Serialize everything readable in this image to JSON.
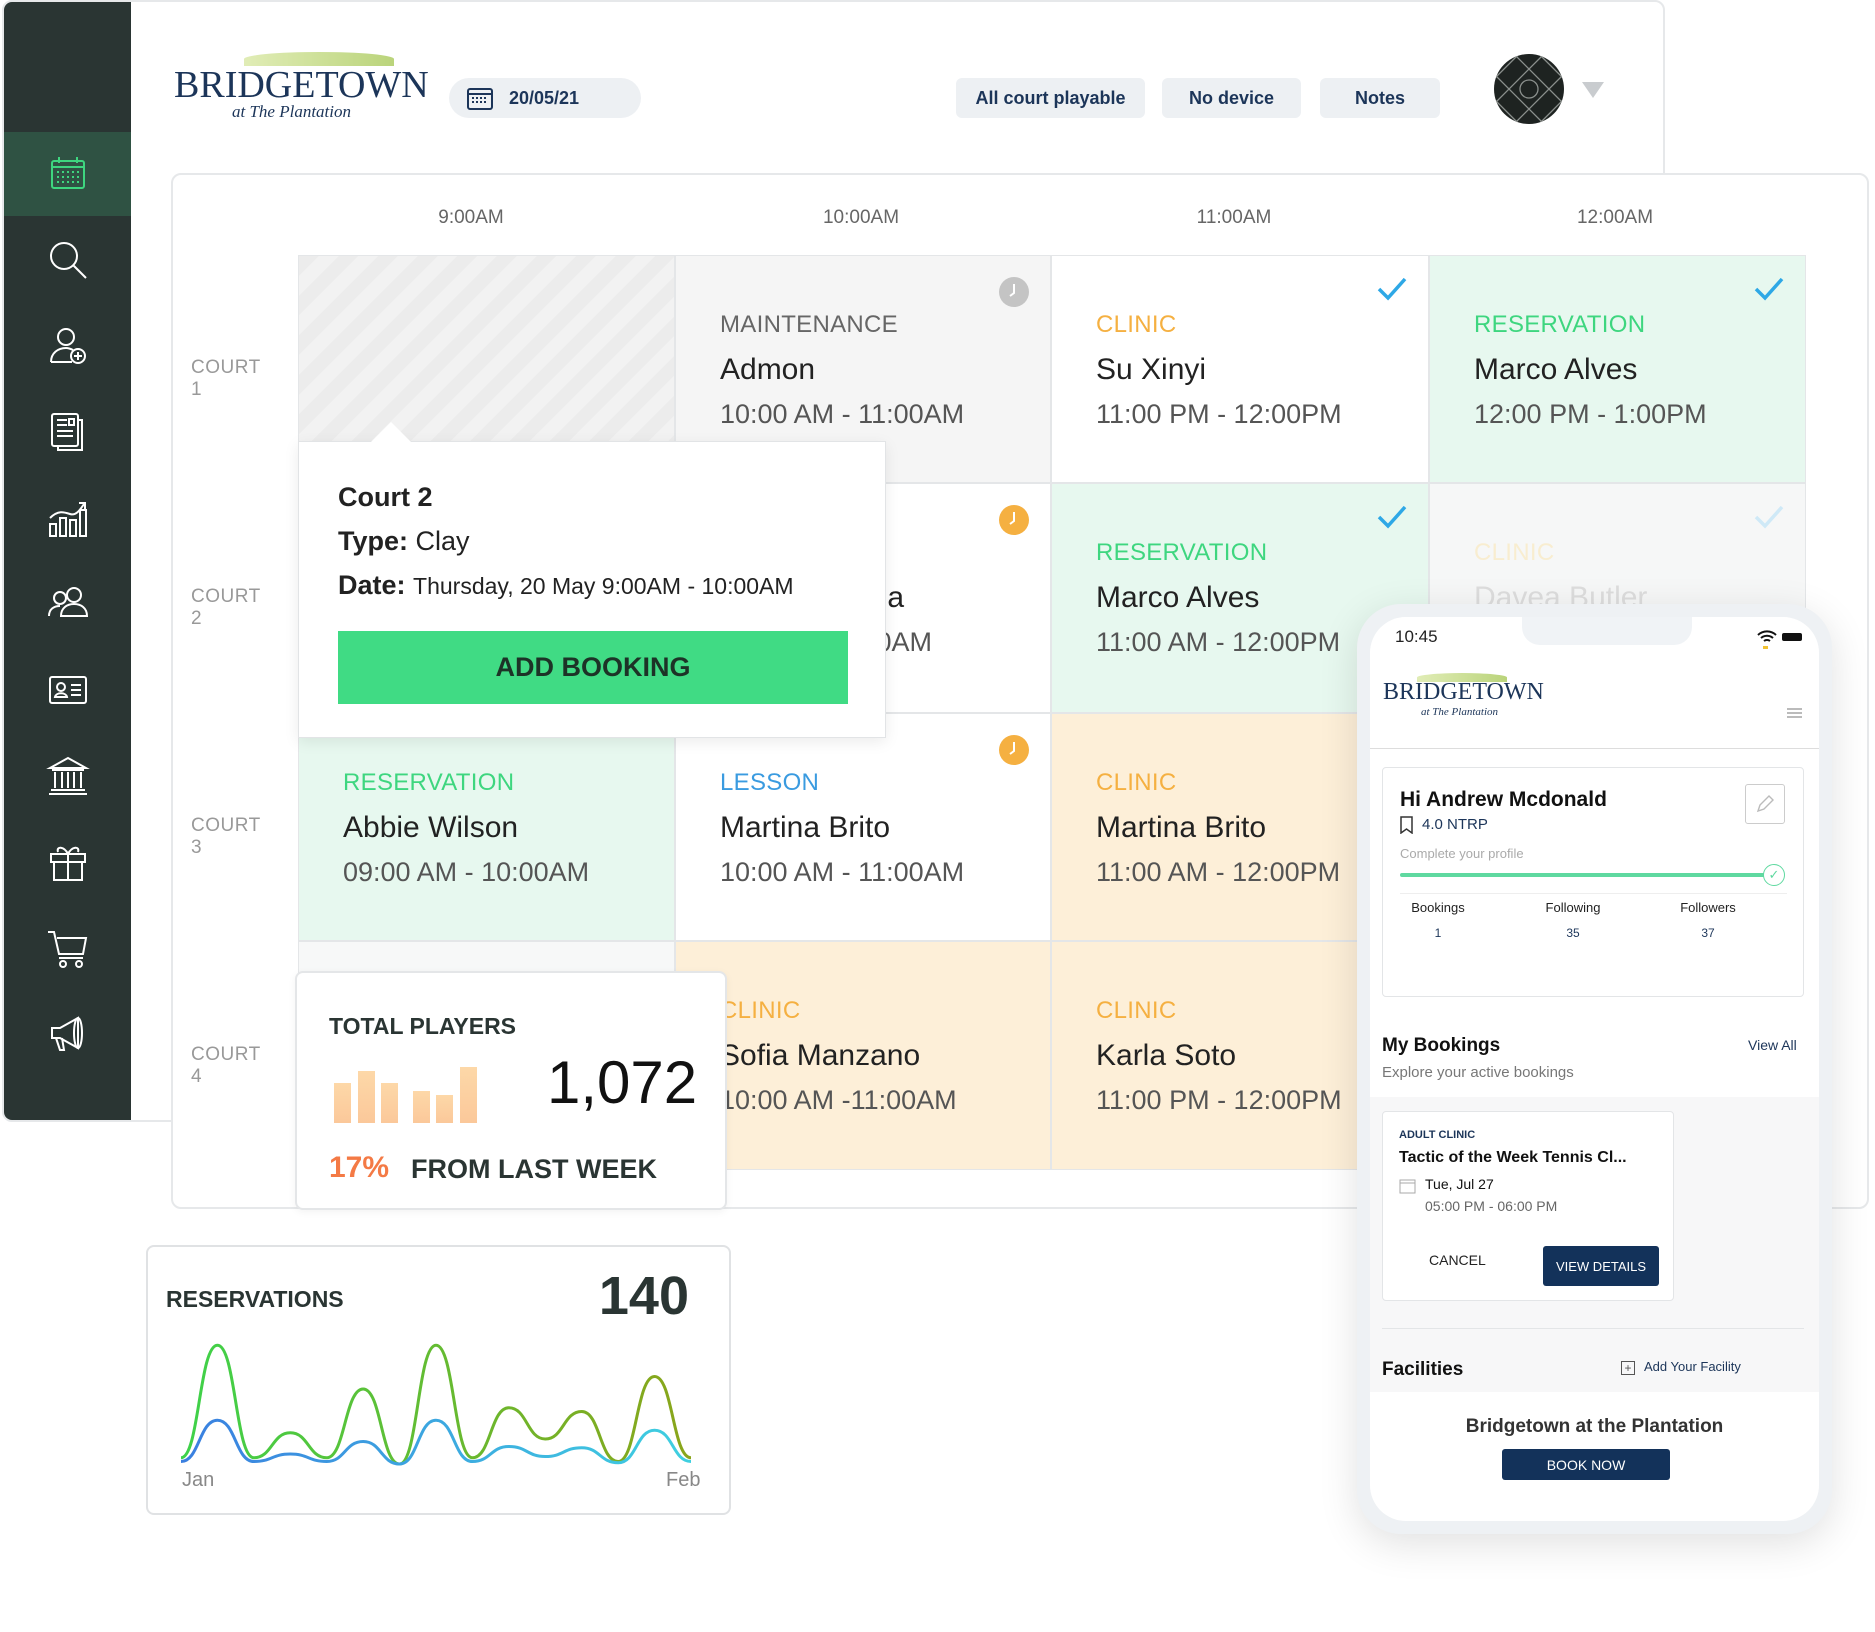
{
  "brand": {
    "name": "BRIDGETOWN",
    "tagline": "at The Plantation"
  },
  "colors": {
    "sidebar": "#2a3533",
    "accent_green": "#3ed67f",
    "clinic": "#f5b041",
    "reservation": "#3ed67f",
    "lesson": "#3a9be0",
    "maintenance": "#666666",
    "navy": "#13325a",
    "orange_pct": "#f47a45"
  },
  "sidebar": {
    "items": [
      {
        "icon": "calendar-icon",
        "active": true
      },
      {
        "icon": "search-icon"
      },
      {
        "icon": "add-user-icon"
      },
      {
        "icon": "news-icon"
      },
      {
        "icon": "chart-growth-icon"
      },
      {
        "icon": "users-icon"
      },
      {
        "icon": "id-card-icon"
      },
      {
        "icon": "bank-icon"
      },
      {
        "icon": "gift-icon"
      },
      {
        "icon": "cart-icon"
      },
      {
        "icon": "megaphone-icon"
      }
    ]
  },
  "header": {
    "date": "20/05/21",
    "buttons": [
      "All court playable",
      "No device",
      "Notes"
    ]
  },
  "calendar": {
    "times": [
      "9:00AM",
      "10:00AM",
      "11:00AM",
      "12:00AM"
    ],
    "courts": [
      "COURT 1",
      "COURT 2",
      "COURT 3",
      "COURT 4"
    ],
    "cells": [
      [
        {
          "type": "empty"
        },
        {
          "type": "maintenance",
          "cat": "MAINTENANCE",
          "name": "Admon",
          "time": "10:00 AM - 11:00AM",
          "icon": "clock-gray"
        },
        {
          "type": "clinic-white",
          "cat": "CLINIC",
          "name": "Su Xinyi",
          "time": "11:00 PM - 12:00PM",
          "icon": "check"
        },
        {
          "type": "reservation",
          "cat": "RESERVATION",
          "name": "Marco Alves",
          "time": "12:00 PM - 1:00PM",
          "icon": "check"
        }
      ],
      [
        {
          "type": "blank"
        },
        {
          "type": "partial",
          "name": "ega",
          "time": ":00AM",
          "icon": "clock-orange"
        },
        {
          "type": "reservation",
          "cat": "RESERVATION",
          "name": "Marco Alves",
          "time": "11:00 AM -  12:00PM",
          "icon": "check"
        },
        {
          "type": "faded",
          "cat": "CLINIC",
          "name": "Davea Butler",
          "icon": "check"
        }
      ],
      [
        {
          "type": "reservation",
          "cat": "RESERVATION",
          "name": "Abbie Wilson",
          "time": "09:00 AM - 10:00AM"
        },
        {
          "type": "lesson",
          "cat": "LESSON",
          "name": "Martina Brito",
          "time": "10:00 AM - 11:00AM",
          "icon": "clock-orange"
        },
        {
          "type": "clinic",
          "cat": "CLINIC",
          "name": "Martina Brito",
          "time": "11:00 AM - 12:00PM"
        },
        {
          "type": "blank"
        }
      ],
      [
        {
          "type": "blank"
        },
        {
          "type": "clinic",
          "cat": "CLINIC",
          "name": "Sofia Manzano",
          "time": "10:00 AM -11:00AM"
        },
        {
          "type": "clinic",
          "cat": "CLINIC",
          "name": "Karla Soto",
          "time": "11:00 PM - 12:00PM"
        },
        {
          "type": "blank"
        }
      ]
    ]
  },
  "popover": {
    "title": "Court 2",
    "type_label": "Type:",
    "type_value": "Clay",
    "date_label": "Date:",
    "date_value": "Thursday, 20 May 9:00AM - 10:00AM",
    "button": "ADD BOOKING"
  },
  "total_players": {
    "title": "TOTAL PLAYERS",
    "value": "1,072",
    "change": "17%",
    "change_label": "FROM LAST WEEK",
    "bars": [
      40,
      52,
      40,
      32,
      28,
      56
    ]
  },
  "reservations": {
    "title": "RESERVATIONS",
    "value": "140",
    "x_start": "Jan",
    "x_end": "Feb",
    "series": [
      [
        5,
        95,
        5,
        25,
        5,
        60,
        0,
        95,
        5,
        45,
        20,
        42,
        2,
        70,
        5
      ],
      [
        2,
        35,
        2,
        8,
        2,
        18,
        0,
        35,
        2,
        14,
        6,
        13,
        1,
        27,
        2
      ]
    ]
  },
  "phone": {
    "time": "10:45",
    "greeting": "Hi Andrew Mcdonald",
    "rating": "4.0 NTRP",
    "profile_prompt": "Complete your profile",
    "profile_progress": 1.0,
    "stats": [
      {
        "label": "Bookings",
        "value": "1"
      },
      {
        "label": "Following",
        "value": "35"
      },
      {
        "label": "Followers",
        "value": "37"
      }
    ],
    "my_bookings": {
      "title": "My Bookings",
      "view_all": "View All",
      "subtitle": "Explore your active bookings"
    },
    "booking": {
      "category": "ADULT CLINIC",
      "title": "Tactic of the Week Tennis Cl...",
      "date": "Tue, Jul 27",
      "time": "05:00 PM - 06:00 PM",
      "cancel": "CANCEL",
      "details": "VIEW DETAILS"
    },
    "facilities": {
      "title": "Facilities",
      "add": "Add Your Facility",
      "name": "Bridgetown at the Plantation",
      "book": "BOOK NOW"
    }
  }
}
